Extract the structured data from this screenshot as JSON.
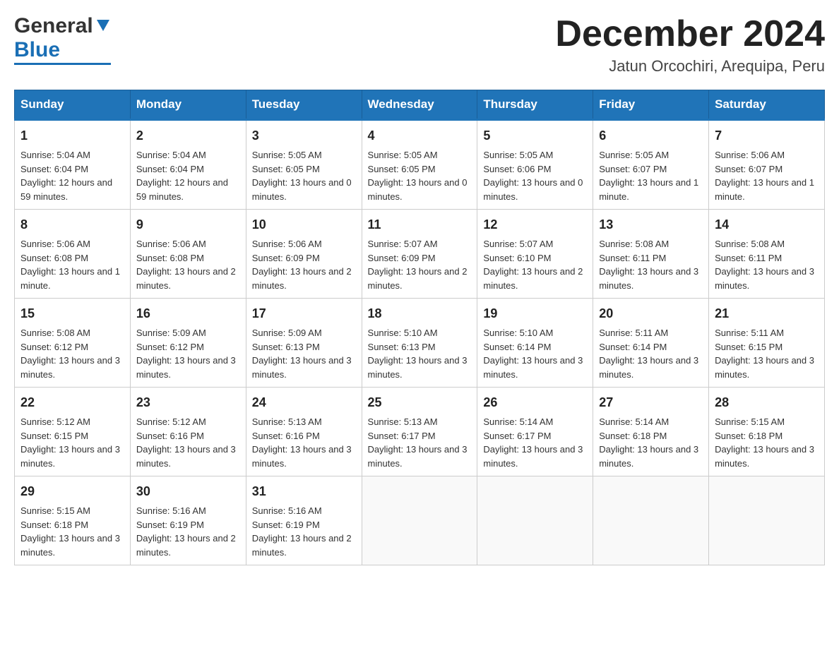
{
  "header": {
    "logo_general": "General",
    "logo_blue": "Blue",
    "month_title": "December 2024",
    "location": "Jatun Orcochiri, Arequipa, Peru"
  },
  "days_of_week": [
    "Sunday",
    "Monday",
    "Tuesday",
    "Wednesday",
    "Thursday",
    "Friday",
    "Saturday"
  ],
  "weeks": [
    [
      {
        "day": "1",
        "sunrise": "5:04 AM",
        "sunset": "6:04 PM",
        "daylight": "12 hours and 59 minutes."
      },
      {
        "day": "2",
        "sunrise": "5:04 AM",
        "sunset": "6:04 PM",
        "daylight": "12 hours and 59 minutes."
      },
      {
        "day": "3",
        "sunrise": "5:05 AM",
        "sunset": "6:05 PM",
        "daylight": "13 hours and 0 minutes."
      },
      {
        "day": "4",
        "sunrise": "5:05 AM",
        "sunset": "6:05 PM",
        "daylight": "13 hours and 0 minutes."
      },
      {
        "day": "5",
        "sunrise": "5:05 AM",
        "sunset": "6:06 PM",
        "daylight": "13 hours and 0 minutes."
      },
      {
        "day": "6",
        "sunrise": "5:05 AM",
        "sunset": "6:07 PM",
        "daylight": "13 hours and 1 minute."
      },
      {
        "day": "7",
        "sunrise": "5:06 AM",
        "sunset": "6:07 PM",
        "daylight": "13 hours and 1 minute."
      }
    ],
    [
      {
        "day": "8",
        "sunrise": "5:06 AM",
        "sunset": "6:08 PM",
        "daylight": "13 hours and 1 minute."
      },
      {
        "day": "9",
        "sunrise": "5:06 AM",
        "sunset": "6:08 PM",
        "daylight": "13 hours and 2 minutes."
      },
      {
        "day": "10",
        "sunrise": "5:06 AM",
        "sunset": "6:09 PM",
        "daylight": "13 hours and 2 minutes."
      },
      {
        "day": "11",
        "sunrise": "5:07 AM",
        "sunset": "6:09 PM",
        "daylight": "13 hours and 2 minutes."
      },
      {
        "day": "12",
        "sunrise": "5:07 AM",
        "sunset": "6:10 PM",
        "daylight": "13 hours and 2 minutes."
      },
      {
        "day": "13",
        "sunrise": "5:08 AM",
        "sunset": "6:11 PM",
        "daylight": "13 hours and 3 minutes."
      },
      {
        "day": "14",
        "sunrise": "5:08 AM",
        "sunset": "6:11 PM",
        "daylight": "13 hours and 3 minutes."
      }
    ],
    [
      {
        "day": "15",
        "sunrise": "5:08 AM",
        "sunset": "6:12 PM",
        "daylight": "13 hours and 3 minutes."
      },
      {
        "day": "16",
        "sunrise": "5:09 AM",
        "sunset": "6:12 PM",
        "daylight": "13 hours and 3 minutes."
      },
      {
        "day": "17",
        "sunrise": "5:09 AM",
        "sunset": "6:13 PM",
        "daylight": "13 hours and 3 minutes."
      },
      {
        "day": "18",
        "sunrise": "5:10 AM",
        "sunset": "6:13 PM",
        "daylight": "13 hours and 3 minutes."
      },
      {
        "day": "19",
        "sunrise": "5:10 AM",
        "sunset": "6:14 PM",
        "daylight": "13 hours and 3 minutes."
      },
      {
        "day": "20",
        "sunrise": "5:11 AM",
        "sunset": "6:14 PM",
        "daylight": "13 hours and 3 minutes."
      },
      {
        "day": "21",
        "sunrise": "5:11 AM",
        "sunset": "6:15 PM",
        "daylight": "13 hours and 3 minutes."
      }
    ],
    [
      {
        "day": "22",
        "sunrise": "5:12 AM",
        "sunset": "6:15 PM",
        "daylight": "13 hours and 3 minutes."
      },
      {
        "day": "23",
        "sunrise": "5:12 AM",
        "sunset": "6:16 PM",
        "daylight": "13 hours and 3 minutes."
      },
      {
        "day": "24",
        "sunrise": "5:13 AM",
        "sunset": "6:16 PM",
        "daylight": "13 hours and 3 minutes."
      },
      {
        "day": "25",
        "sunrise": "5:13 AM",
        "sunset": "6:17 PM",
        "daylight": "13 hours and 3 minutes."
      },
      {
        "day": "26",
        "sunrise": "5:14 AM",
        "sunset": "6:17 PM",
        "daylight": "13 hours and 3 minutes."
      },
      {
        "day": "27",
        "sunrise": "5:14 AM",
        "sunset": "6:18 PM",
        "daylight": "13 hours and 3 minutes."
      },
      {
        "day": "28",
        "sunrise": "5:15 AM",
        "sunset": "6:18 PM",
        "daylight": "13 hours and 3 minutes."
      }
    ],
    [
      {
        "day": "29",
        "sunrise": "5:15 AM",
        "sunset": "6:18 PM",
        "daylight": "13 hours and 3 minutes."
      },
      {
        "day": "30",
        "sunrise": "5:16 AM",
        "sunset": "6:19 PM",
        "daylight": "13 hours and 2 minutes."
      },
      {
        "day": "31",
        "sunrise": "5:16 AM",
        "sunset": "6:19 PM",
        "daylight": "13 hours and 2 minutes."
      },
      null,
      null,
      null,
      null
    ]
  ],
  "labels": {
    "sunrise": "Sunrise:",
    "sunset": "Sunset:",
    "daylight": "Daylight:"
  }
}
